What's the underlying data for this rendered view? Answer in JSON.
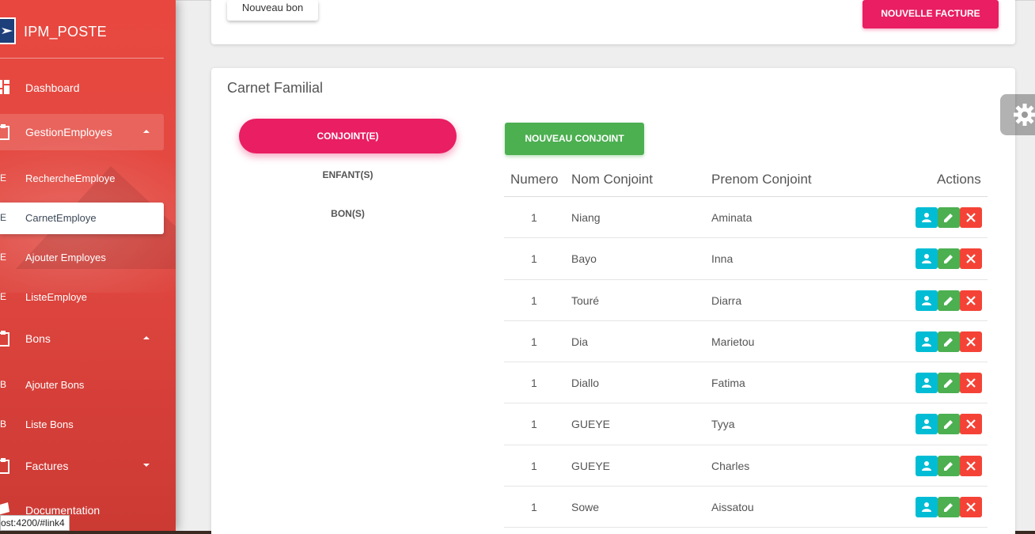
{
  "sidebar": {
    "app_name": "IPM_POSTE",
    "items": [
      {
        "label": "Dashboard",
        "icon": "dashboard-icon"
      },
      {
        "label": "GestionEmployes",
        "icon": "clipboard-icon"
      },
      {
        "label": "Bons",
        "icon": "clipboard-icon"
      },
      {
        "label": "Factures",
        "icon": "clipboard-icon"
      },
      {
        "label": "Documentation",
        "icon": "book-icon"
      }
    ],
    "employes_sub": [
      {
        "abbr": "E",
        "label": "RechercheEmploye"
      },
      {
        "abbr": "E",
        "label": "CarnetEmploye"
      },
      {
        "abbr": "E",
        "label": "Ajouter Employes"
      },
      {
        "abbr": "E",
        "label": "ListeEmploye"
      }
    ],
    "bons_sub": [
      {
        "abbr": "B",
        "label": "Ajouter Bons"
      },
      {
        "abbr": "B",
        "label": "Liste Bons"
      }
    ]
  },
  "status_url": "ost:4200/#link4",
  "top_card": {
    "nouveau_bon": "Nouveau bon",
    "nouvelle_facture": "NOUVELLE FACTURE"
  },
  "carnet": {
    "title": "Carnet Familial",
    "tabs": [
      "CONJOINT(E)",
      "ENFANT(S)",
      "BON(S)"
    ],
    "new_button": "NOUVEAU CONJOINT",
    "columns": [
      "Numero",
      "Nom Conjoint",
      "Prenom Conjoint",
      "Actions"
    ],
    "rows": [
      {
        "num": "1",
        "nom": "Niang",
        "prenom": "Aminata"
      },
      {
        "num": "1",
        "nom": "Bayo",
        "prenom": "Inna"
      },
      {
        "num": "1",
        "nom": "Touré",
        "prenom": "Diarra"
      },
      {
        "num": "1",
        "nom": "Dia",
        "prenom": "Marietou"
      },
      {
        "num": "1",
        "nom": "Diallo",
        "prenom": "Fatima"
      },
      {
        "num": "1",
        "nom": "GUEYE",
        "prenom": "Tyya"
      },
      {
        "num": "1",
        "nom": "GUEYE",
        "prenom": "Charles"
      },
      {
        "num": "1",
        "nom": "Sowe",
        "prenom": "Aissatou"
      }
    ]
  },
  "colors": {
    "primary_pink": "#e91e63",
    "success_green": "#4caf50",
    "info_cyan": "#00bcd4",
    "danger_red": "#f44336",
    "sidebar_red": "#e24a42"
  }
}
